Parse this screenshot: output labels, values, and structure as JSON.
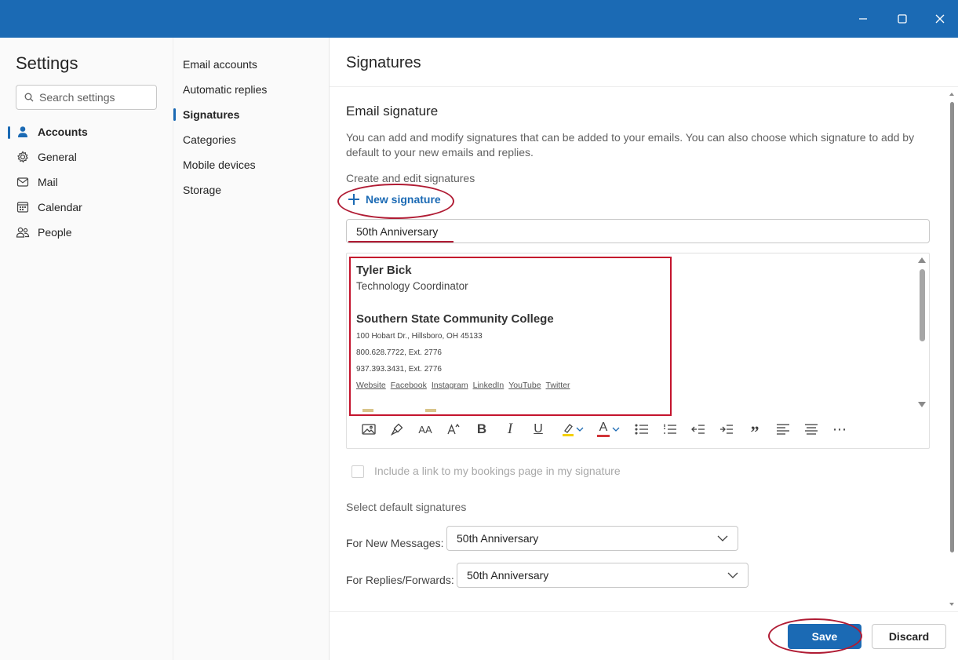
{
  "window_controls": {
    "minimize_icon": "minimize-icon",
    "maximize_icon": "maximize-icon",
    "close_icon": "close-icon"
  },
  "sidebar": {
    "title": "Settings",
    "search_placeholder": "Search settings",
    "items": [
      {
        "label": "Accounts",
        "icon": "person-icon",
        "active": true
      },
      {
        "label": "General",
        "icon": "gear-icon",
        "active": false
      },
      {
        "label": "Mail",
        "icon": "mail-icon",
        "active": false
      },
      {
        "label": "Calendar",
        "icon": "calendar-icon",
        "active": false
      },
      {
        "label": "People",
        "icon": "people-icon",
        "active": false
      }
    ]
  },
  "subnav": {
    "items": [
      {
        "label": "Email accounts",
        "active": false
      },
      {
        "label": "Automatic replies",
        "active": false
      },
      {
        "label": "Signatures",
        "active": true
      },
      {
        "label": "Categories",
        "active": false
      },
      {
        "label": "Mobile devices",
        "active": false
      },
      {
        "label": "Storage",
        "active": false
      }
    ]
  },
  "main": {
    "title": "Signatures",
    "section_heading": "Email signature",
    "description": "You can add and modify signatures that can be added to your emails. You can also choose which signature to add by default to your new emails and replies.",
    "create_label": "Create and edit signatures",
    "new_signature_label": "New signature",
    "signature_name_value": "50th Anniversary",
    "signature": {
      "name": "Tyler Bick",
      "role": "Technology Coordinator",
      "organization": "Southern State Community College",
      "address": "100 Hobart Dr., Hillsboro, OH  45133",
      "phone1": "800.628.7722, Ext. 2776",
      "phone2": "937.393.3431, Ext. 2776",
      "links": [
        "Website",
        "Facebook",
        "Instagram",
        "LinkedIn",
        "YouTube",
        "Twitter"
      ]
    },
    "toolbar": {
      "italic_glyph": "I",
      "underline_glyph": "U",
      "bold_glyph": "B",
      "font_size_glyph": "AA",
      "font_color_glyph": "A",
      "quote_glyph": "”",
      "more_glyph": "⋯"
    },
    "bookings_checkbox_label": "Include a link to my bookings page in my signature",
    "defaults_heading": "Select default signatures",
    "new_messages_label": "For New Messages:",
    "new_messages_value": "50th Anniversary",
    "replies_label": "For Replies/Forwards:",
    "replies_value": "50th Anniversary"
  },
  "footer": {
    "save_label": "Save",
    "discard_label": "Discard"
  },
  "colors": {
    "accent": "#1b6ab4",
    "highlight_ring": "#b01c34",
    "highlight_yellow": "#f5d000",
    "font_color_red": "#d13438"
  }
}
